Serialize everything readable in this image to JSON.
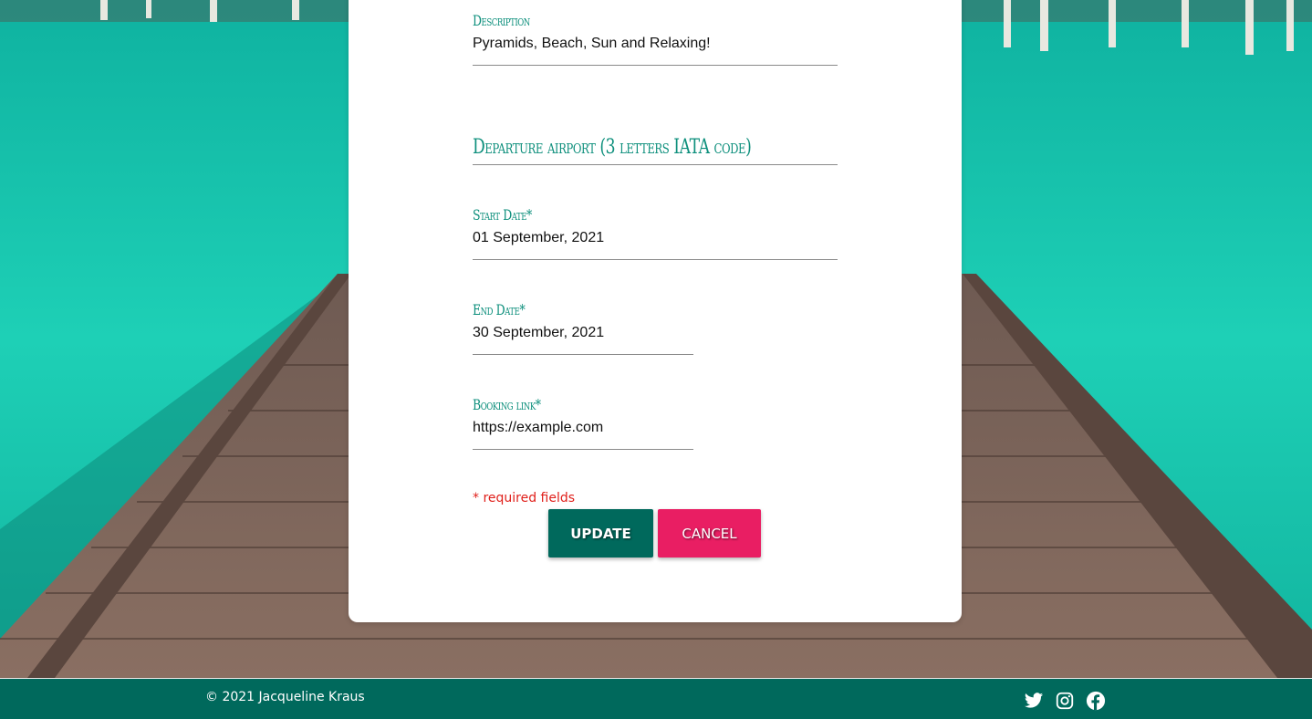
{
  "form": {
    "description": {
      "label": "Description",
      "value": "Pyramids, Beach, Sun and Relaxing!"
    },
    "departure_airport": {
      "label": "Departure airport (3 letters IATA code)",
      "value": ""
    },
    "start_date": {
      "label": "Start Date*",
      "value": "01 September, 2021"
    },
    "end_date": {
      "label": "End Date*",
      "value": "30 September, 2021"
    },
    "booking_link": {
      "label": "Booking link*",
      "value": "https://example.com"
    },
    "required_note": "* required fields",
    "update_label": "UPDATE",
    "cancel_label": "CANCEL"
  },
  "footer": {
    "copyright": "© 2021 Jacqueline Kraus",
    "social_icons": [
      "twitter-icon",
      "instagram-icon",
      "facebook-icon"
    ]
  },
  "colors": {
    "accent": "#00695c",
    "label": "#0d8f7c",
    "cancel": "#e91e63",
    "required": "#e0201b"
  }
}
